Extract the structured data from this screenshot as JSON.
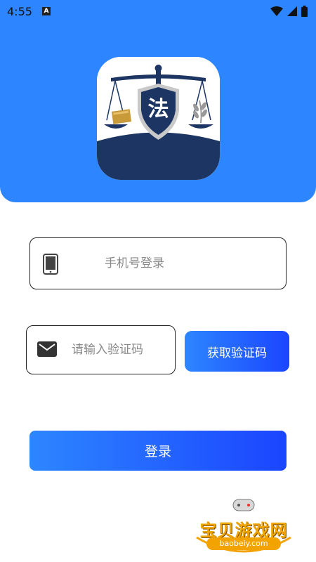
{
  "status_bar": {
    "time": "4:55"
  },
  "header": {
    "logo_char": "法",
    "accent_color": "#2d86ff"
  },
  "form": {
    "phone_placeholder": "手机号登录",
    "phone_value": "",
    "code_placeholder": "请输入验证码",
    "code_value": "",
    "get_code_label": "获取验证码",
    "login_label": "登录"
  },
  "watermark": {
    "title": "宝贝游戏网",
    "url": "baobeiy.com"
  },
  "icons": {
    "phone": "phone-icon",
    "mail": "mail-icon",
    "wifi": "wifi-icon",
    "signal": "signal-icon",
    "battery": "battery-icon"
  }
}
